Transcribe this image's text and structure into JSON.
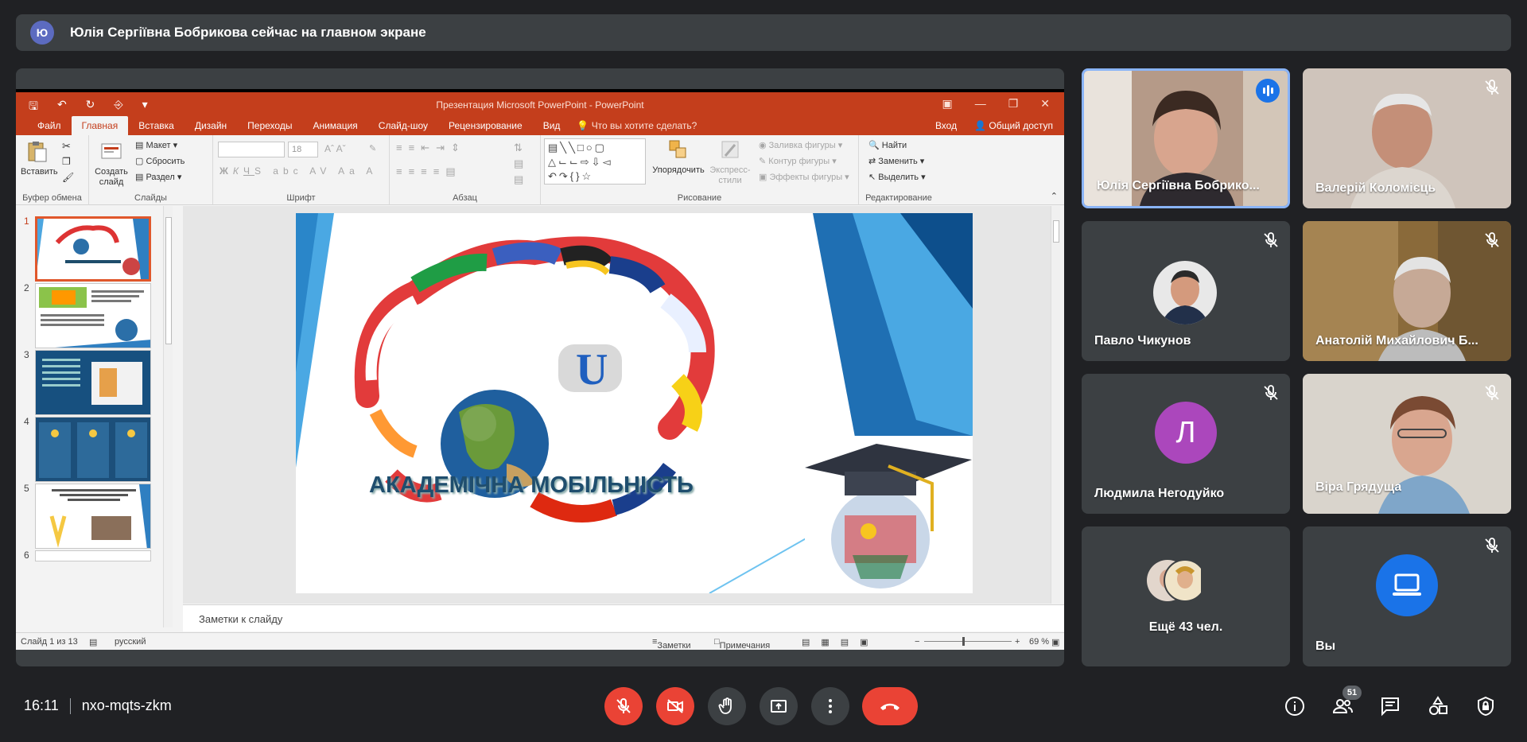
{
  "banner": {
    "avatar_letter": "Ю",
    "text": "Юлія Сергіївна Бобрикова сейчас на главном экране"
  },
  "powerpoint": {
    "window_title": "Презентация Microsoft PowerPoint - PowerPoint",
    "tabs": [
      "Файл",
      "Главная",
      "Вставка",
      "Дизайн",
      "Переходы",
      "Анимация",
      "Слайд-шоу",
      "Рецензирование",
      "Вид"
    ],
    "tell_me": "Что вы хотите сделать?",
    "signin": "Вход",
    "share": "Общий доступ",
    "ribbon": {
      "clipboard": {
        "label": "Буфер обмена",
        "paste": "Вставить"
      },
      "slides": {
        "label": "Слайды",
        "new_slide_1": "Создать",
        "new_slide_2": "слайд",
        "layout": "Макет",
        "reset": "Сбросить",
        "section": "Раздел"
      },
      "font": {
        "label": "Шрифт",
        "size": "18"
      },
      "paragraph": {
        "label": "Абзац"
      },
      "drawing": {
        "label": "Рисование",
        "arrange": "Упорядочить",
        "quick_styles_1": "Экспресс-",
        "quick_styles_2": "стили",
        "fill": "Заливка фигуры",
        "outline": "Контур фигуры",
        "effects": "Эффекты фигуры"
      },
      "editing": {
        "label": "Редактирование",
        "find": "Найти",
        "replace": "Заменить",
        "select": "Выделить"
      }
    },
    "thumbnails": [
      "1",
      "2",
      "3",
      "4",
      "5",
      "6"
    ],
    "slide_title": "АКАДЕМІЧНА МОБІЛЬНІСТЬ",
    "notes_placeholder": "Заметки к слайду",
    "status": {
      "slide_of": "Слайд 1 из 13",
      "language": "русский",
      "notes": "Заметки",
      "comments": "Примечания",
      "zoom": "69 %"
    }
  },
  "participants": [
    {
      "name": "Юлія Сергіївна Бобрико...",
      "speaking": true
    },
    {
      "name": "Валерій Коломієць",
      "muted": true
    },
    {
      "name": "Павло Чикунов",
      "muted": true
    },
    {
      "name": "Анатолій Михайлович Б...",
      "muted": true
    },
    {
      "name": "Людмила Негодуйко",
      "muted": true,
      "avatar_letter": "Л",
      "avatar_color": "#ab47bc"
    },
    {
      "name": "Віра Грядуща",
      "muted": true
    },
    {
      "name": "Ещё 43 чел."
    },
    {
      "name": "Вы",
      "muted": true
    }
  ],
  "meeting": {
    "time": "16:11",
    "code": "nxo-mqts-zkm",
    "participant_count": "51"
  },
  "colors": {
    "accent": "#1a73e8",
    "danger": "#ea4335",
    "ppt": "#c43e1c"
  }
}
